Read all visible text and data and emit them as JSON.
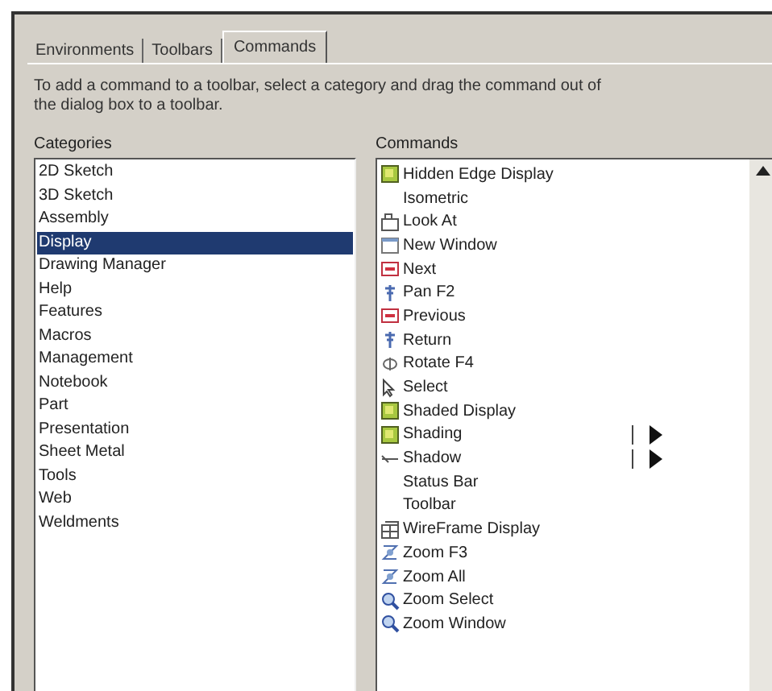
{
  "tabs": [
    {
      "label": "Environments",
      "selected": false
    },
    {
      "label": "Toolbars",
      "selected": false
    },
    {
      "label": "Commands",
      "selected": true
    }
  ],
  "instructions": [
    "To add a command to a toolbar, select a category and drag the command out of",
    "the dialog box to a toolbar."
  ],
  "categories": {
    "label": "Categories",
    "items": [
      {
        "label": "2D Sketch",
        "selected": false
      },
      {
        "label": "3D Sketch",
        "selected": false
      },
      {
        "label": "Assembly",
        "selected": false
      },
      {
        "label": "Display",
        "selected": true
      },
      {
        "label": "Drawing Manager",
        "selected": false
      },
      {
        "label": "Help",
        "selected": false
      },
      {
        "label": "Features",
        "selected": false
      },
      {
        "label": "Macros",
        "selected": false
      },
      {
        "label": "Management",
        "selected": false
      },
      {
        "label": "Notebook",
        "selected": false
      },
      {
        "label": "Part",
        "selected": false
      },
      {
        "label": "Presentation",
        "selected": false
      },
      {
        "label": "Sheet Metal",
        "selected": false
      },
      {
        "label": "Tools",
        "selected": false
      },
      {
        "label": "Web",
        "selected": false
      },
      {
        "label": "Weldments",
        "selected": false
      }
    ]
  },
  "commands": {
    "label": "Commands",
    "items": [
      {
        "label": "Hidden Edge Display",
        "kind": "shade",
        "submenu": false
      },
      {
        "label": "Isometric",
        "kind": "none",
        "submenu": false
      },
      {
        "label": "Look At",
        "kind": "camera",
        "submenu": false
      },
      {
        "label": "New Window",
        "kind": "window",
        "submenu": false
      },
      {
        "label": "Next",
        "kind": "page",
        "submenu": false
      },
      {
        "label": "Pan  F2",
        "kind": "pan",
        "submenu": false
      },
      {
        "label": "Previous",
        "kind": "page",
        "submenu": false
      },
      {
        "label": "Return",
        "kind": "pan",
        "submenu": false
      },
      {
        "label": "Rotate  F4",
        "kind": "rotate",
        "submenu": false
      },
      {
        "label": "Select",
        "kind": "cursor",
        "submenu": false
      },
      {
        "label": "Shaded Display",
        "kind": "shade",
        "submenu": false
      },
      {
        "label": "Shading",
        "kind": "shade",
        "submenu": true
      },
      {
        "label": "Shadow",
        "kind": "shadow",
        "submenu": true
      },
      {
        "label": "Status Bar",
        "kind": "none",
        "submenu": false
      },
      {
        "label": "Toolbar",
        "kind": "none",
        "submenu": false
      },
      {
        "label": "WireFrame Display",
        "kind": "wire",
        "submenu": false
      },
      {
        "label": "Zoom  F3",
        "kind": "zoom",
        "submenu": false
      },
      {
        "label": "Zoom All",
        "kind": "zoom",
        "submenu": false
      },
      {
        "label": "Zoom Select",
        "kind": "magnifier",
        "submenu": false
      },
      {
        "label": "Zoom Window",
        "kind": "magnifier",
        "submenu": false
      }
    ]
  }
}
